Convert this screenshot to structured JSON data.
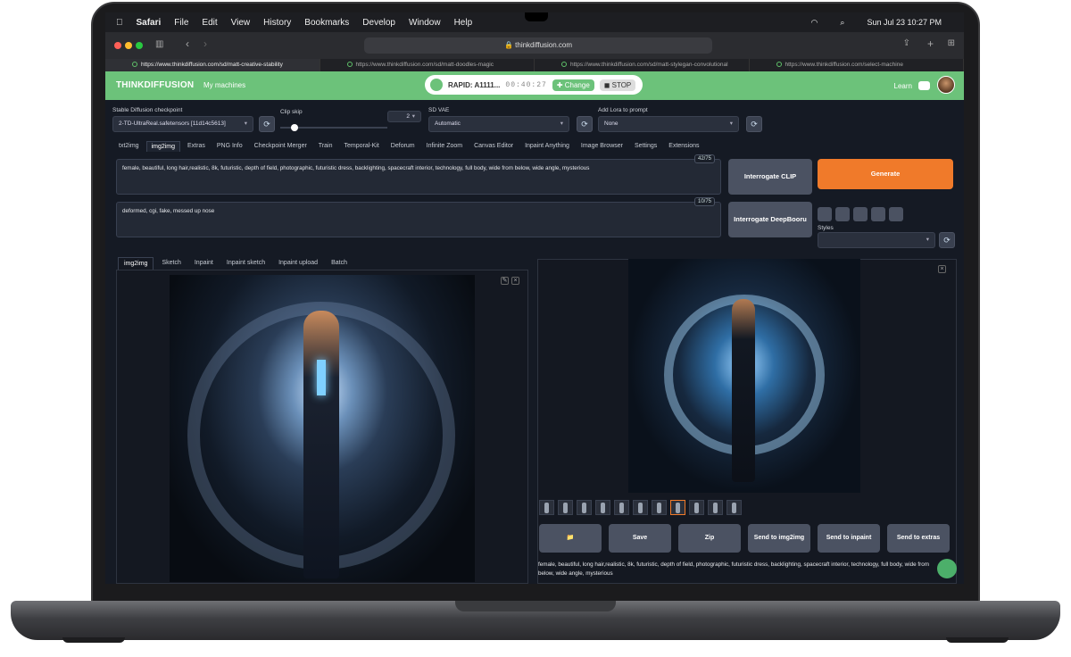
{
  "menubar": {
    "apple": "",
    "app": "Safari",
    "items": [
      "File",
      "Edit",
      "View",
      "History",
      "Bookmarks",
      "Develop",
      "Window",
      "Help"
    ],
    "clock": "Sun Jul 23  10:27 PM"
  },
  "safari": {
    "url": "thinkdiffusion.com",
    "tabs": [
      "https://www.thinkdiffusion.com/sd/matt-creative-stability",
      "https://www.thinkdiffusion.com/sd/matt-doodles-magic",
      "https://www.thinkdiffusion.com/sd/matt-stylegan-convolutional",
      "https://www.thinkdiffusion.com/select-machine"
    ]
  },
  "header": {
    "logo": "THINKDIFFUSION",
    "my_machines": "My machines",
    "machine": "RAPID: A1111...",
    "timer": "00:40:27",
    "change": "✚ Change",
    "stop": "◼ STOP",
    "learn": "Learn"
  },
  "settings": {
    "checkpoint_label": "Stable Diffusion checkpoint",
    "checkpoint_value": "2-TD-UltraReal.safetensors [11d14c5613]",
    "clip_label": "Clip skip",
    "clip_value": "2",
    "vae_label": "SD VAE",
    "vae_value": "Automatic",
    "lora_label": "Add Lora to prompt",
    "lora_value": "None"
  },
  "tabs": [
    "txt2img",
    "img2img",
    "Extras",
    "PNG Info",
    "Checkpoint Merger",
    "Train",
    "Temporal-Kit",
    "Deforum",
    "Infinite Zoom",
    "Canvas Editor",
    "Inpaint Anything",
    "Image Browser",
    "Settings",
    "Extensions"
  ],
  "prompt": {
    "text": "female, beautiful, long hair,realistic, 8k, futuristic, depth of field, photographic, futuristic dress, backlighting, spacecraft interior, technology, full body, wide from below, wide angle, mysterious",
    "count": "42/75"
  },
  "negative": {
    "text": "deformed, cgi, fake, messed up nose",
    "count": "10/75"
  },
  "buttons": {
    "clip": "Interrogate CLIP",
    "deepbooru": "Interrogate DeepBooru",
    "generate": "Generate",
    "styles": "Styles"
  },
  "subtabs": [
    "img2img",
    "Sketch",
    "Inpaint",
    "Inpaint sketch",
    "Inpaint upload",
    "Batch"
  ],
  "actions": [
    "📁",
    "Save",
    "Zip",
    "Send to img2img",
    "Send to inpaint",
    "Send to extras"
  ],
  "output_text": "female, beautiful, long hair,realistic, 8k, futuristic, depth of field, photographic, futuristic dress, backlighting, spacecraft interior, technology, full body, wide from below, wide angle, mysterious"
}
